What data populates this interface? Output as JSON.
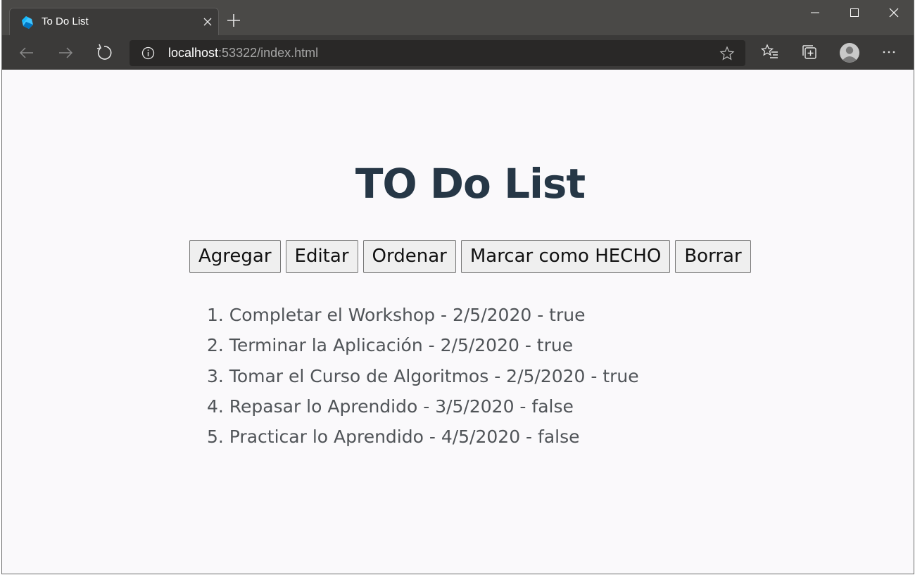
{
  "browser": {
    "tab_title": "To Do List",
    "url_host": "localhost",
    "url_rest": ":53322/index.html"
  },
  "page": {
    "heading": "TO Do List",
    "buttons": {
      "add": "Agregar",
      "edit": "Editar",
      "sort": "Ordenar",
      "mark_done": "Marcar como HECHO",
      "delete": "Borrar"
    },
    "tasks": [
      "1. Completar el Workshop - 2/5/2020 - true",
      "2. Terminar la Aplicación - 2/5/2020 - true",
      "3. Tomar el Curso de Algoritmos - 2/5/2020 - true",
      "4. Repasar lo Aprendido - 3/5/2020 - false",
      "5. Practicar lo Aprendido - 4/5/2020 - false"
    ]
  },
  "icons": {
    "favicon": "dart-logo-icon",
    "tab_close": "close-icon",
    "new_tab": "plus-icon",
    "back": "arrow-left-icon",
    "forward": "arrow-right-icon",
    "reload": "refresh-icon",
    "site_info": "info-icon",
    "favorite": "star-icon",
    "favorites_hub": "favorites-list-icon",
    "collections": "collections-icon",
    "profile": "avatar-icon",
    "more": "more-icon"
  },
  "colors": {
    "heading": "#263746",
    "task_text": "#505458",
    "page_bg": "#faf9fb",
    "titlebar": "#4a4947",
    "toolbar": "#3b3a39"
  }
}
